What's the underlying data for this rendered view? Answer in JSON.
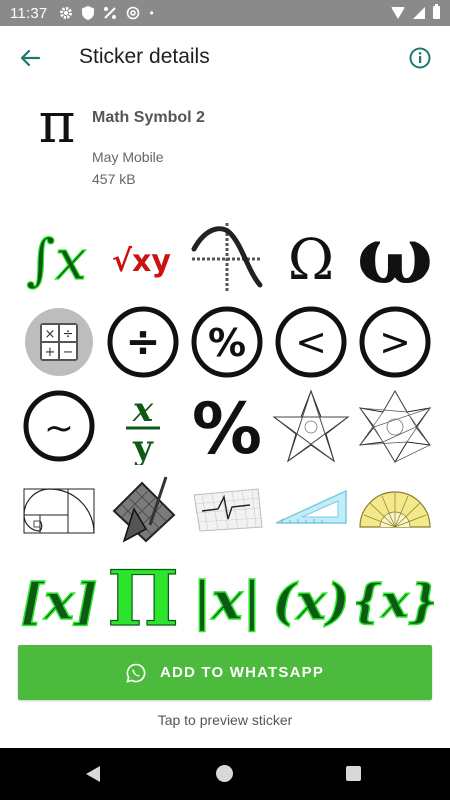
{
  "status_bar": {
    "time": "11:37",
    "dot": "•"
  },
  "app_bar": {
    "title": "Sticker details",
    "accent_color": "#1b7a6e"
  },
  "pack": {
    "icon_glyph": "π",
    "name": "Math Symbol 2",
    "publisher": "May Mobile",
    "size": "457 kB"
  },
  "stickers": {
    "row1": [
      "integral-x",
      "sqrt-xy",
      "bell-curve-graph",
      "omega-upper",
      "omega-lower"
    ],
    "row2": [
      "calculator",
      "divide-circle",
      "percent-circle",
      "less-than-circle",
      "greater-than-circle"
    ],
    "row3": [
      "tilde-circle",
      "x-over-y",
      "percent-large",
      "pentagram",
      "nonagram"
    ],
    "row4": [
      "golden-spiral",
      "drafting-tools",
      "grid-waveform",
      "set-square",
      "protractor"
    ],
    "row5": [
      "bracket-x",
      "pi-green",
      "abs-x",
      "paren-x",
      "brace-x"
    ],
    "texts": {
      "integral": "∫x",
      "sqrt": "√xy",
      "omega_upper": "Ω",
      "omega_lower": "ω",
      "divide": "÷",
      "percent": "%",
      "less": "<",
      "greater": ">",
      "tilde": "~",
      "x": "x",
      "y": "y",
      "bracket_x": "[x]",
      "pi": "Π",
      "abs_x": "|x|",
      "paren_x": "(x)",
      "brace_x": "{x}",
      "calc_keys": [
        "×",
        "÷",
        "+",
        "−"
      ]
    },
    "colors": {
      "dark_green": "#0c5a14",
      "bright_green": "#2ee52e",
      "red": "#cc1111",
      "black": "#111111"
    }
  },
  "actions": {
    "add_label": "ADD TO WHATSAPP",
    "preview_hint": "Tap to preview sticker",
    "button_color": "#4cba3d"
  }
}
